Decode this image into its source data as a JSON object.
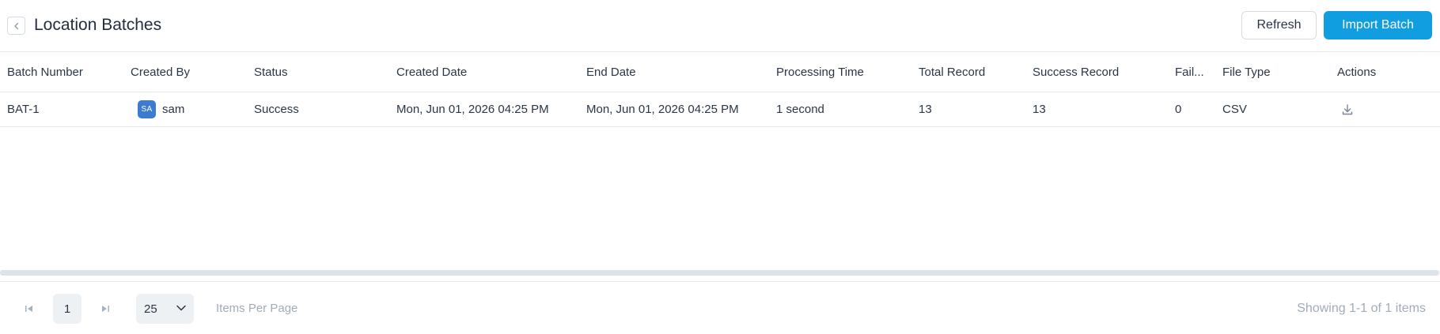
{
  "header": {
    "title": "Location Batches",
    "refresh_label": "Refresh",
    "import_label": "Import Batch"
  },
  "table": {
    "columns": [
      "Batch Number",
      "Created By",
      "Status",
      "Created Date",
      "End Date",
      "Processing Time",
      "Total Record",
      "Success Record",
      "Fail...",
      "File Type",
      "Actions"
    ],
    "rows": [
      {
        "batch_number": "BAT-1",
        "avatar_initials": "SA",
        "created_by": "sam",
        "status": "Success",
        "created_date": "Mon, Jun 01, 2026 04:25 PM",
        "end_date": "Mon, Jun 01, 2026 04:25 PM",
        "processing_time": "1 second",
        "total_record": "13",
        "success_record": "13",
        "failed_record": "0",
        "file_type": "CSV",
        "action_icon": "download-icon"
      }
    ]
  },
  "pagination": {
    "current_page": "1",
    "page_size": "25",
    "items_per_page_label": "Items Per Page",
    "showing_text": "Showing 1-1 of 1 items"
  },
  "colors": {
    "primary": "#119ee0",
    "avatar": "#3b7bd1",
    "muted_text": "#a2acb8",
    "border": "#e3e6ea"
  }
}
